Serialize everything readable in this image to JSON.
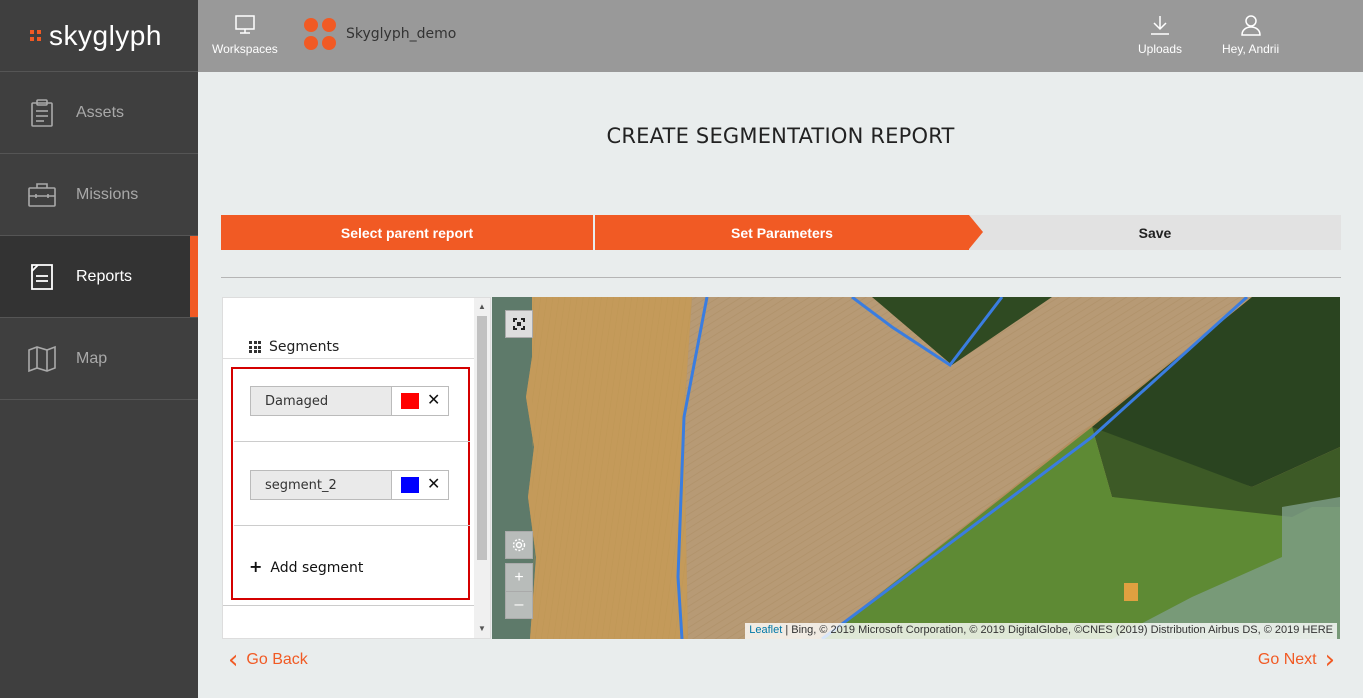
{
  "app": {
    "logo_text": "skyglyph"
  },
  "sidebar": {
    "items": [
      {
        "label": "Assets",
        "icon": "clipboard-icon",
        "active": false
      },
      {
        "label": "Missions",
        "icon": "briefcase-icon",
        "active": false
      },
      {
        "label": "Reports",
        "icon": "document-icon",
        "active": true
      },
      {
        "label": "Map",
        "icon": "map-icon",
        "active": false
      }
    ]
  },
  "topbar": {
    "workspaces_label": "Workspaces",
    "workspace_name": "Skyglyph_demo",
    "uploads_label": "Uploads",
    "user_label": "Hey, Andrii"
  },
  "page": {
    "title": "CREATE SEGMENTATION REPORT"
  },
  "steps": [
    {
      "label": "Select parent report",
      "state": "done"
    },
    {
      "label": "Set Parameters",
      "state": "current"
    },
    {
      "label": "Save",
      "state": "pending"
    }
  ],
  "segments": {
    "header": "Segments",
    "items": [
      {
        "name": "Damaged",
        "color": "#ff0000"
      },
      {
        "name": "segment_2",
        "color": "#0000ff"
      }
    ],
    "add_label": "Add segment"
  },
  "map": {
    "attribution_link": "Leaflet",
    "attribution_text": " | Bing, © 2019 Microsoft Corporation, © 2019 DigitalGlobe, ©CNES (2019) Distribution Airbus DS, © 2019 HERE",
    "zoom_in": "+",
    "zoom_out": "–"
  },
  "footer": {
    "back_label": "Go Back",
    "next_label": "Go Next"
  },
  "colors": {
    "accent": "#f15a24",
    "sidebar_bg": "#3f3f3f",
    "topbar_bg": "#999999",
    "boundary": "#3a7de0"
  }
}
